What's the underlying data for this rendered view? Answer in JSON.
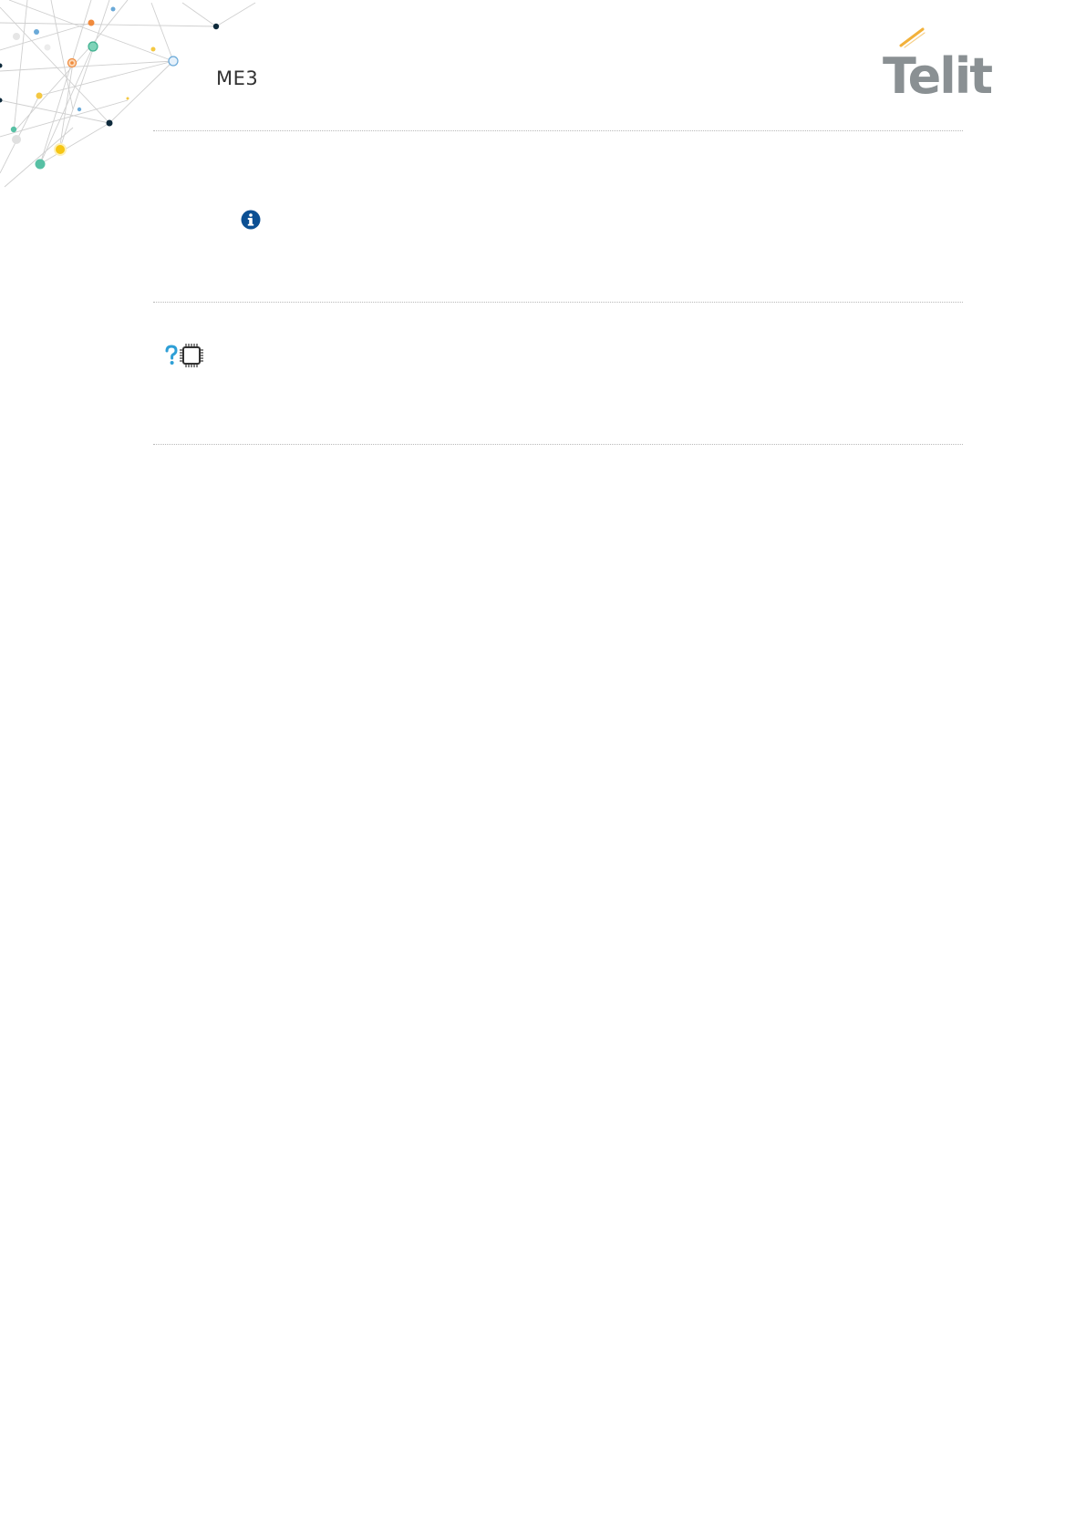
{
  "header": {
    "doc_code": "ME3",
    "logo_text": "Telit"
  },
  "icons": {
    "info": "info-icon",
    "note_question": "question-icon",
    "note_chip": "chip-icon"
  },
  "colors": {
    "logo_gray": "#8a9093",
    "logo_accent": "#f2b13a",
    "info_blue": "#0b4f93",
    "question_blue": "#2e9fd6"
  }
}
